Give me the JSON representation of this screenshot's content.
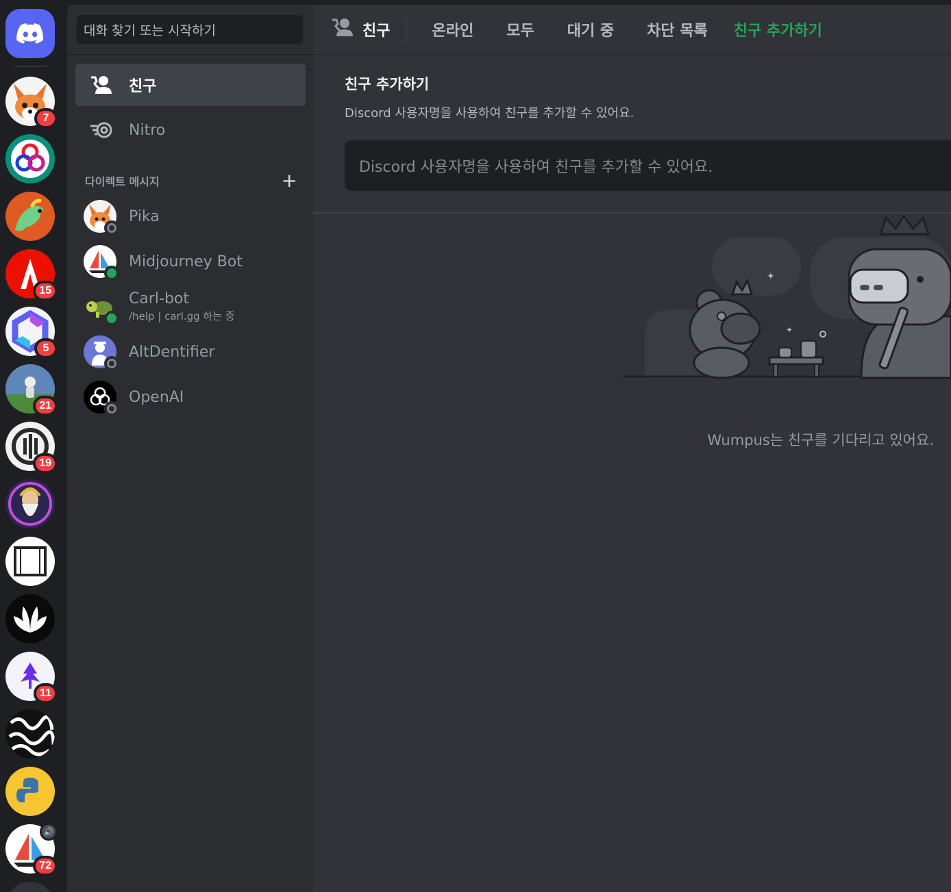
{
  "servers": [
    {
      "name": "home",
      "badge": ""
    },
    {
      "name": "pika",
      "badge": "7"
    },
    {
      "name": "openai-swirl",
      "badge": ""
    },
    {
      "name": "horse-art",
      "badge": ""
    },
    {
      "name": "adobe",
      "badge": "15"
    },
    {
      "name": "hexagon",
      "badge": "5"
    },
    {
      "name": "astronaut",
      "badge": "21"
    },
    {
      "name": "audio-logo",
      "badge": "19"
    },
    {
      "name": "wizard",
      "badge": ""
    },
    {
      "name": "film-frame",
      "badge": ""
    },
    {
      "name": "lotus",
      "badge": ""
    },
    {
      "name": "purple-tree",
      "badge": "11"
    },
    {
      "name": "pattern",
      "badge": ""
    },
    {
      "name": "python",
      "badge": ""
    },
    {
      "name": "sailboat",
      "badge": "72",
      "voice_icon": "🔊"
    }
  ],
  "sidebar": {
    "search_placeholder": "대화 찾기 또는 시작하기",
    "nav": [
      {
        "label": "친구",
        "icon": "friends-icon",
        "active": true
      },
      {
        "label": "Nitro",
        "icon": "nitro-icon",
        "active": false
      }
    ],
    "dm_header": "다이렉트 메시지",
    "dm_add": "+",
    "dms": [
      {
        "name": "Pika",
        "status": "offline",
        "sub": ""
      },
      {
        "name": "Midjourney Bot",
        "status": "online",
        "sub": ""
      },
      {
        "name": "Carl-bot",
        "status": "online",
        "sub": "/help | carl.gg 하는 중"
      },
      {
        "name": "AltDentifier",
        "status": "offline",
        "sub": ""
      },
      {
        "name": "OpenAI",
        "status": "offline",
        "sub": ""
      }
    ]
  },
  "topbar": {
    "title": "친구",
    "tabs": [
      "온라인",
      "모두",
      "대기 중",
      "차단 목록"
    ],
    "add_friend_tab": "친구 추가하기"
  },
  "add_friend": {
    "title": "친구 추가하기",
    "description": "Discord 사용자명을 사용하여 친구를 추가할 수 있어요.",
    "placeholder": "Discord 사용자명을 사용하여 친구를 추가할 수 있어요."
  },
  "empty_state": "Wumpus는 친구를 기다리고 있어요.",
  "colors": {
    "accent": "#5865f2",
    "green": "#23a55a",
    "badge": "#f23f42"
  }
}
